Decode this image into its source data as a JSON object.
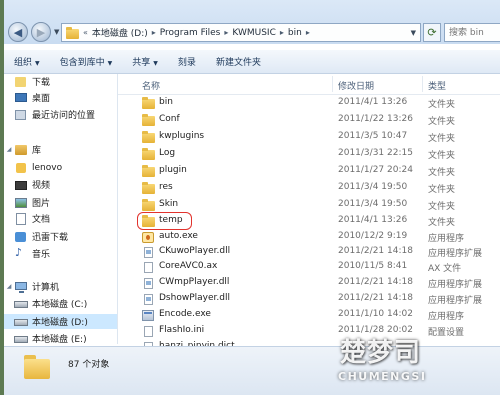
{
  "address": {
    "nav_chevron": "«",
    "segments": [
      "本地磁盘 (D:)",
      "Program Files",
      "KWMUSIC",
      "bin"
    ],
    "separator": "▸",
    "search_placeholder": "搜索 bin"
  },
  "toolbar": {
    "items": [
      "组织",
      "包含到库中",
      "共享",
      "刻录",
      "新建文件夹"
    ]
  },
  "nav": {
    "items": [
      {
        "label": "下载",
        "icon": "download-folder-icon"
      },
      {
        "label": "桌面",
        "icon": "desktop-icon"
      },
      {
        "label": "最近访问的位置",
        "icon": "recent-places-icon"
      },
      {
        "label": "库",
        "icon": "library-icon"
      },
      {
        "label": "lenovo",
        "icon": "user-folder-icon"
      },
      {
        "label": "视频",
        "icon": "video-library-icon"
      },
      {
        "label": "图片",
        "icon": "pictures-library-icon"
      },
      {
        "label": "文档",
        "icon": "documents-library-icon"
      },
      {
        "label": "迅雷下载",
        "icon": "thunder-download-icon"
      },
      {
        "label": "音乐",
        "icon": "music-library-icon"
      },
      {
        "label": "计算机",
        "icon": "computer-icon"
      },
      {
        "label": "本地磁盘 (C:)",
        "icon": "drive-icon"
      },
      {
        "label": "本地磁盘 (D:)",
        "icon": "drive-icon"
      },
      {
        "label": "本地磁盘 (E:)",
        "icon": "drive-icon"
      }
    ]
  },
  "columns": {
    "name": "名称",
    "date": "修改日期",
    "type": "类型"
  },
  "files": [
    {
      "name": "bin",
      "date": "2011/4/1 13:26",
      "type": "文件夹",
      "icon": "folder"
    },
    {
      "name": "Conf",
      "date": "2011/1/22 13:26",
      "type": "文件夹",
      "icon": "folder"
    },
    {
      "name": "kwplugins",
      "date": "2011/3/5 10:47",
      "type": "文件夹",
      "icon": "folder"
    },
    {
      "name": "Log",
      "date": "2011/3/31 22:15",
      "type": "文件夹",
      "icon": "folder"
    },
    {
      "name": "plugin",
      "date": "2011/1/27 20:24",
      "type": "文件夹",
      "icon": "folder"
    },
    {
      "name": "res",
      "date": "2011/3/4 19:50",
      "type": "文件夹",
      "icon": "folder"
    },
    {
      "name": "Skin",
      "date": "2011/3/4 19:50",
      "type": "文件夹",
      "icon": "folder"
    },
    {
      "name": "temp",
      "date": "2011/4/1 13:26",
      "type": "文件夹",
      "icon": "folder"
    },
    {
      "name": "auto.exe",
      "date": "2010/12/2 9:19",
      "type": "应用程序",
      "icon": "auto"
    },
    {
      "name": "CKuwoPlayer.dll",
      "date": "2011/2/21 14:18",
      "type": "应用程序扩展",
      "icon": "dll"
    },
    {
      "name": "CoreAVC0.ax",
      "date": "2010/11/5 8:41",
      "type": "AX 文件",
      "icon": "file"
    },
    {
      "name": "CWmpPlayer.dll",
      "date": "2011/2/21 14:18",
      "type": "应用程序扩展",
      "icon": "dll"
    },
    {
      "name": "DshowPlayer.dll",
      "date": "2011/2/21 14:18",
      "type": "应用程序扩展",
      "icon": "dll"
    },
    {
      "name": "Encode.exe",
      "date": "2011/1/10 14:02",
      "type": "应用程序",
      "icon": "exe"
    },
    {
      "name": "FlashIo.ini",
      "date": "2011/1/28 20:02",
      "type": "配置设置",
      "icon": "file"
    },
    {
      "name": "hanzi_pinyin.dict",
      "date": "",
      "type": "",
      "icon": "file"
    }
  ],
  "status": {
    "count_text": "87 个对象"
  },
  "watermark": {
    "cn": "楚梦司",
    "en": "CHUMENGSI"
  }
}
